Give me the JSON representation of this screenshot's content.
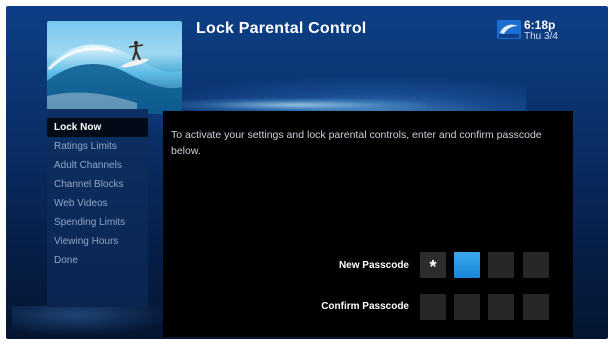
{
  "header": {
    "title": "Lock Parental Control",
    "brand_icon": "directv-logo-icon",
    "time": "6:18p",
    "date": "Thu 3/4"
  },
  "sidebar": {
    "items": [
      {
        "label": "Lock Now",
        "active": true
      },
      {
        "label": "Ratings Limits",
        "active": false
      },
      {
        "label": "Adult Channels",
        "active": false
      },
      {
        "label": "Channel Blocks",
        "active": false
      },
      {
        "label": "Web Videos",
        "active": false
      },
      {
        "label": "Spending Limits",
        "active": false
      },
      {
        "label": "Viewing Hours",
        "active": false
      },
      {
        "label": "Done",
        "active": false
      }
    ]
  },
  "main": {
    "instructions": "To activate your settings and lock parental controls, enter and confirm passcode below.",
    "new_passcode": {
      "label": "New Passcode",
      "digits": [
        "*",
        "",
        "",
        ""
      ]
    },
    "confirm_passcode": {
      "label": "Confirm Passcode",
      "digits": [
        "",
        "",
        "",
        ""
      ]
    }
  },
  "colors": {
    "background": "#0a2f69",
    "panel": "#000000",
    "focus_box": "#1985d6",
    "menu_active_bg": "#020a18"
  }
}
